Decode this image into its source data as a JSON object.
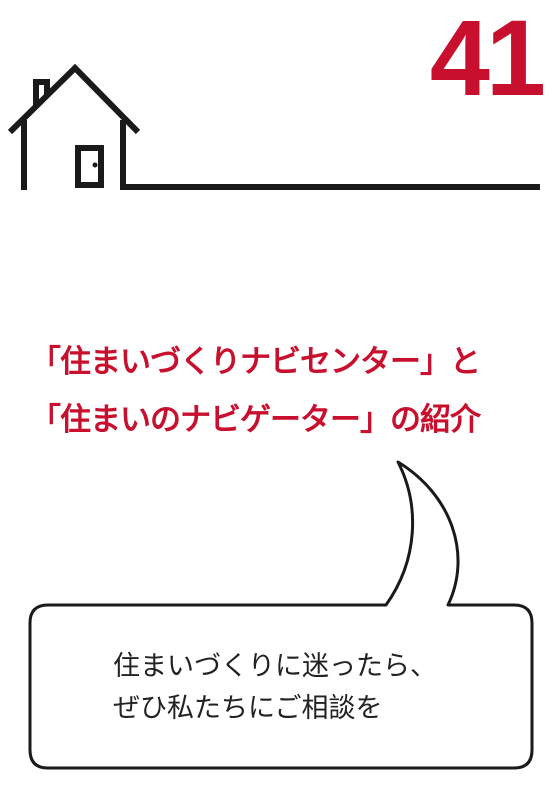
{
  "page": {
    "number": "41"
  },
  "headline": {
    "line1": "「住まいづくりナビセンター」と",
    "line2": "「住まいのナビゲーター」の紹介"
  },
  "speech_bubble": {
    "line1": "住まいづくりに迷ったら、",
    "line2": "ぜひ私たちにご相談を"
  },
  "colors": {
    "accent": "#c8102e",
    "ink": "#1a1a1a"
  },
  "icons": {
    "house": "house-icon",
    "bubble": "speech-bubble-icon"
  }
}
